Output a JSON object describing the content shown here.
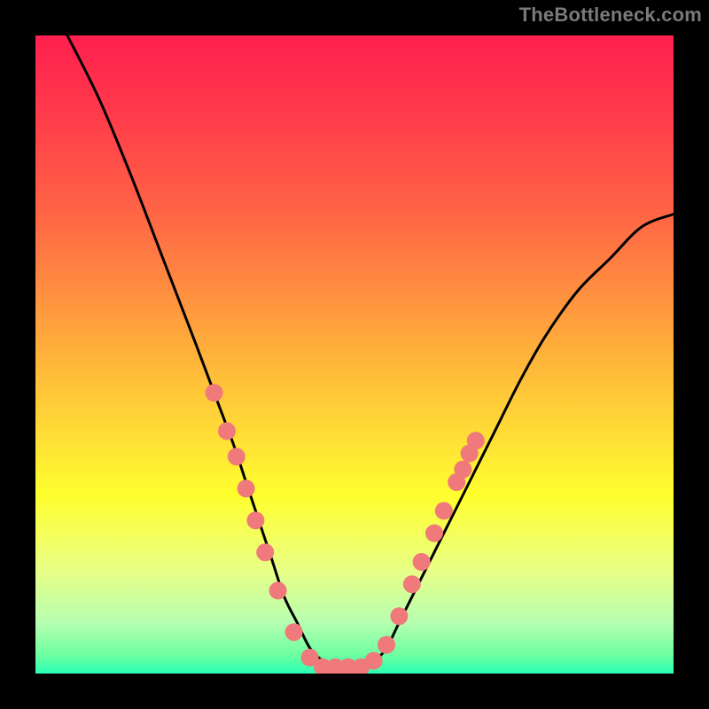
{
  "watermark": {
    "text": "TheBottleneck.com"
  },
  "chart_data": {
    "type": "line",
    "title": "",
    "xlabel": "",
    "ylabel": "",
    "xlim": [
      0,
      100
    ],
    "ylim": [
      0,
      100
    ],
    "series": [
      {
        "name": "curve",
        "x": [
          5,
          10,
          15,
          20,
          25,
          28,
          31,
          33,
          35,
          37,
          39,
          41,
          43,
          45,
          47,
          50,
          53,
          55,
          57,
          60,
          64,
          68,
          72,
          76,
          80,
          85,
          90,
          95,
          100
        ],
        "y": [
          100,
          90,
          78,
          65,
          52,
          44,
          36,
          30,
          24,
          18,
          12,
          8,
          4,
          2,
          1,
          1,
          2,
          4,
          8,
          14,
          22,
          30,
          38,
          46,
          53,
          60,
          65,
          70,
          72
        ]
      }
    ],
    "markers": [
      {
        "x": 28.0,
        "y": 44.0
      },
      {
        "x": 30.0,
        "y": 38.0
      },
      {
        "x": 31.5,
        "y": 34.0
      },
      {
        "x": 33.0,
        "y": 29.0
      },
      {
        "x": 34.5,
        "y": 24.0
      },
      {
        "x": 36.0,
        "y": 19.0
      },
      {
        "x": 38.0,
        "y": 13.0
      },
      {
        "x": 40.5,
        "y": 6.5
      },
      {
        "x": 43.0,
        "y": 2.5
      },
      {
        "x": 45.0,
        "y": 1.0
      },
      {
        "x": 47.0,
        "y": 1.0
      },
      {
        "x": 49.0,
        "y": 1.0
      },
      {
        "x": 51.0,
        "y": 1.0
      },
      {
        "x": 53.0,
        "y": 2.0
      },
      {
        "x": 55.0,
        "y": 4.5
      },
      {
        "x": 57.0,
        "y": 9.0
      },
      {
        "x": 59.0,
        "y": 14.0
      },
      {
        "x": 60.5,
        "y": 17.5
      },
      {
        "x": 62.5,
        "y": 22.0
      },
      {
        "x": 64.0,
        "y": 25.5
      },
      {
        "x": 66.0,
        "y": 30.0
      },
      {
        "x": 67.0,
        "y": 32.0
      },
      {
        "x": 68.0,
        "y": 34.5
      },
      {
        "x": 69.0,
        "y": 36.5
      }
    ],
    "marker_color": "#f0797b",
    "curve_color": "#000000",
    "grid": false,
    "legend": false
  }
}
